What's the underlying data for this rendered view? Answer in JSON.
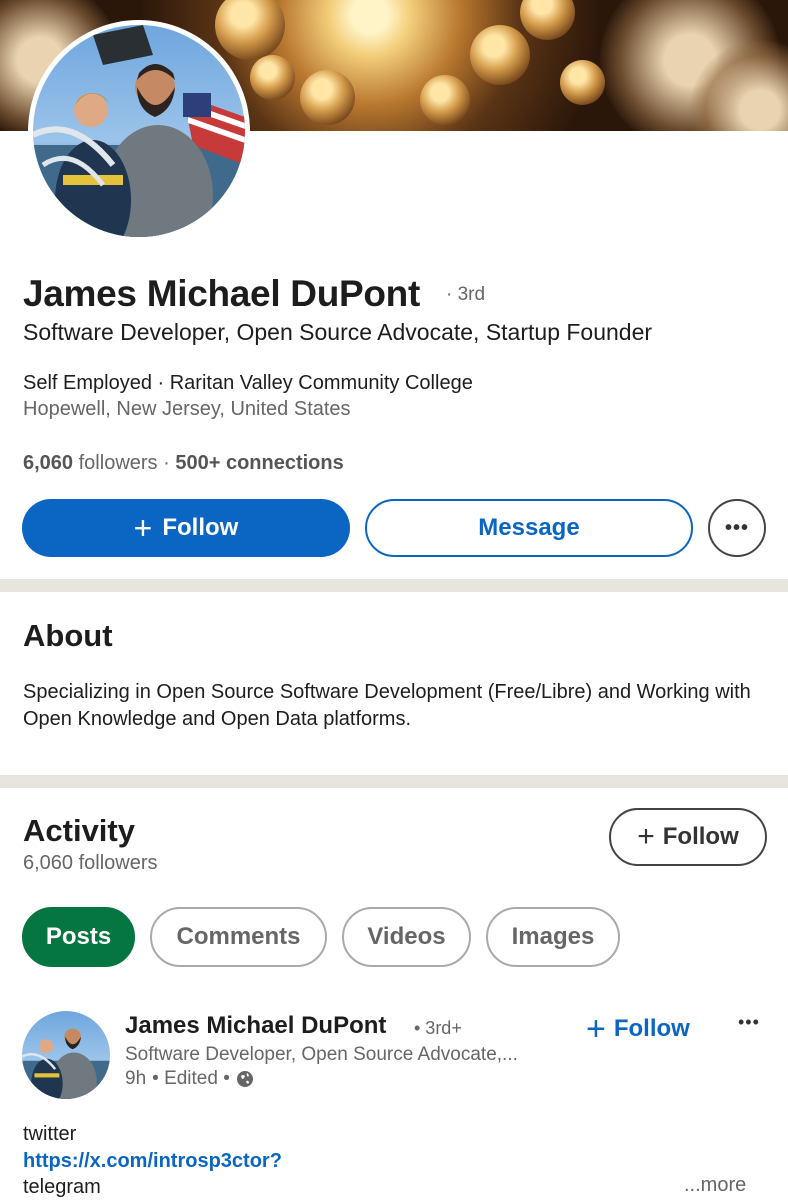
{
  "profile": {
    "name": "James Michael DuPont",
    "degree": "· 3rd",
    "headline": "Software Developer, Open Source Advocate, Startup Founder",
    "employer": "Self Employed · Raritan Valley Community College",
    "location": "Hopewell, New Jersey, United States",
    "followers_count": "6,060",
    "followers_word": "followers",
    "stats_separator": "·",
    "connections": "500+ connections"
  },
  "actions": {
    "follow_label": "Follow",
    "message_label": "Message",
    "more_label": "•••",
    "plus_glyph": "+"
  },
  "about": {
    "title": "About",
    "text": "Specializing in Open Source Software Development (Free/Libre) and Working with Open Knowledge and Open Data platforms."
  },
  "activity": {
    "title": "Activity",
    "followers": "6,060 followers",
    "follow_label": "Follow",
    "tabs": [
      {
        "label": "Posts",
        "active": true
      },
      {
        "label": "Comments",
        "active": false
      },
      {
        "label": "Videos",
        "active": false
      },
      {
        "label": "Images",
        "active": false
      }
    ]
  },
  "post": {
    "author": "James Michael DuPont",
    "degree": "• 3rd+",
    "headline": "Software Developer, Open Source Advocate,...",
    "time": "9h",
    "edited": "• Edited •",
    "visibility_icon": "globe-icon",
    "follow_label": "Follow",
    "more_label": "•••",
    "line1": "twitter",
    "link": "https://x.com/introsp3ctor?",
    "line3": "telegram",
    "see_more": "...more"
  },
  "colors": {
    "linkedin_blue": "#0a66c2",
    "posts_green": "#057642",
    "divider": "#e8e5df"
  }
}
